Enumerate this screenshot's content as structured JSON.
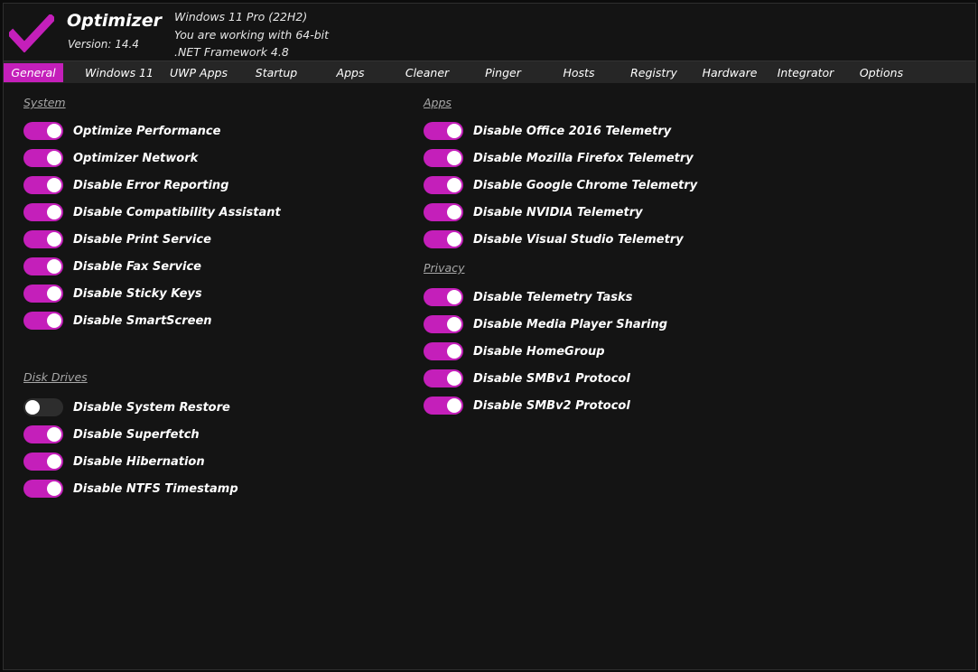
{
  "app": {
    "title": "Optimizer",
    "version": "Version: 14.4",
    "accent_color": "#c41fba",
    "logo_icon": "checkmark-icon"
  },
  "system_info": {
    "os": "Windows 11 Pro (22H2)",
    "arch": "You are working with 64-bit",
    "framework": ".NET Framework 4.8"
  },
  "tabs": [
    {
      "label": "General",
      "active": true
    },
    {
      "label": "Windows 11",
      "active": false
    },
    {
      "label": "UWP Apps",
      "active": false
    },
    {
      "label": "Startup",
      "active": false
    },
    {
      "label": "Apps",
      "active": false
    },
    {
      "label": "Cleaner",
      "active": false
    },
    {
      "label": "Pinger",
      "active": false
    },
    {
      "label": "Hosts",
      "active": false
    },
    {
      "label": "Registry",
      "active": false
    },
    {
      "label": "Hardware",
      "active": false
    },
    {
      "label": "Integrator",
      "active": false
    },
    {
      "label": "Options",
      "active": false
    }
  ],
  "sections": {
    "system": {
      "title": "System",
      "items": [
        {
          "label": "Optimize Performance",
          "on": true
        },
        {
          "label": "Optimizer Network",
          "on": true
        },
        {
          "label": "Disable Error Reporting",
          "on": true
        },
        {
          "label": "Disable Compatibility Assistant",
          "on": true
        },
        {
          "label": "Disable Print Service",
          "on": true
        },
        {
          "label": "Disable Fax Service",
          "on": true
        },
        {
          "label": "Disable Sticky Keys",
          "on": true
        },
        {
          "label": "Disable SmartScreen",
          "on": true
        }
      ]
    },
    "disk_drives": {
      "title": "Disk Drives",
      "items": [
        {
          "label": "Disable System Restore",
          "on": false
        },
        {
          "label": "Disable Superfetch",
          "on": true
        },
        {
          "label": "Disable Hibernation",
          "on": true
        },
        {
          "label": "Disable NTFS Timestamp",
          "on": true
        }
      ]
    },
    "apps": {
      "title": "Apps",
      "items": [
        {
          "label": "Disable Office 2016 Telemetry",
          "on": true
        },
        {
          "label": "Disable Mozilla Firefox Telemetry",
          "on": true
        },
        {
          "label": "Disable Google Chrome Telemetry",
          "on": true
        },
        {
          "label": "Disable NVIDIA Telemetry",
          "on": true
        },
        {
          "label": "Disable Visual Studio Telemetry",
          "on": true
        }
      ]
    },
    "privacy": {
      "title": "Privacy",
      "items": [
        {
          "label": "Disable Telemetry Tasks",
          "on": true
        },
        {
          "label": "Disable Media Player Sharing",
          "on": true
        },
        {
          "label": "Disable HomeGroup",
          "on": true
        },
        {
          "label": "Disable SMBv1 Protocol",
          "on": true
        },
        {
          "label": "Disable SMBv2 Protocol",
          "on": true
        }
      ]
    }
  }
}
